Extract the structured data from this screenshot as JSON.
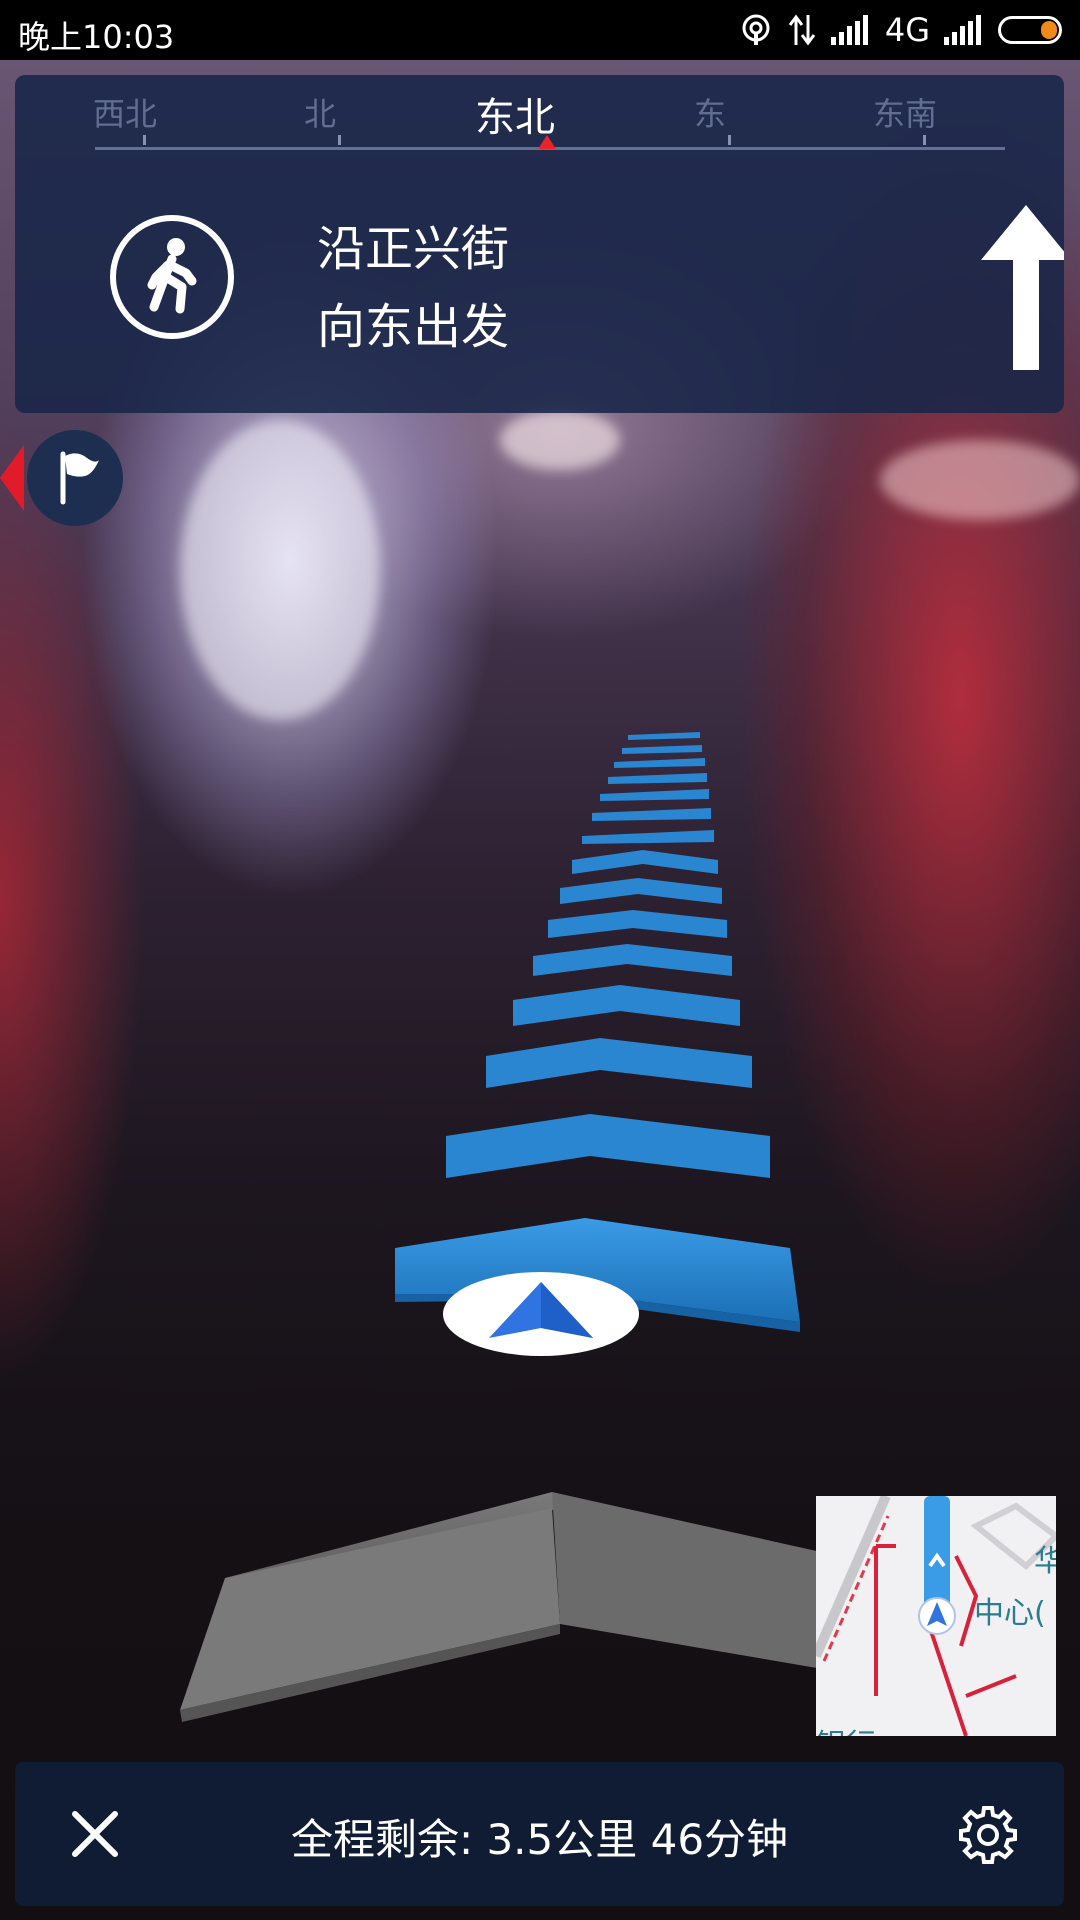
{
  "status_bar": {
    "time": "晚上10:03",
    "network": "4G",
    "battery_color": "#f08a1b"
  },
  "compass": {
    "labels": [
      "西北",
      "北",
      "东北",
      "东",
      "东南"
    ],
    "active": "东北",
    "pointer_color": "#e8232b"
  },
  "instruction": {
    "line1": "沿正兴街",
    "line2": "向东出发",
    "mode_icon": "pedestrian-icon",
    "turn_icon": "arrow-up-icon"
  },
  "destination_flag": {
    "icon": "flag-icon"
  },
  "ar_path": {
    "color": "#2a86d0",
    "location_marker": "navigation-arrow-icon"
  },
  "mini_map": {
    "labels": [
      "华",
      "中心(",
      "银行"
    ]
  },
  "bottom_bar": {
    "remaining": "全程剩余: 3.5公里 46分钟",
    "close_icon": "close-icon",
    "settings_icon": "gear-icon"
  }
}
